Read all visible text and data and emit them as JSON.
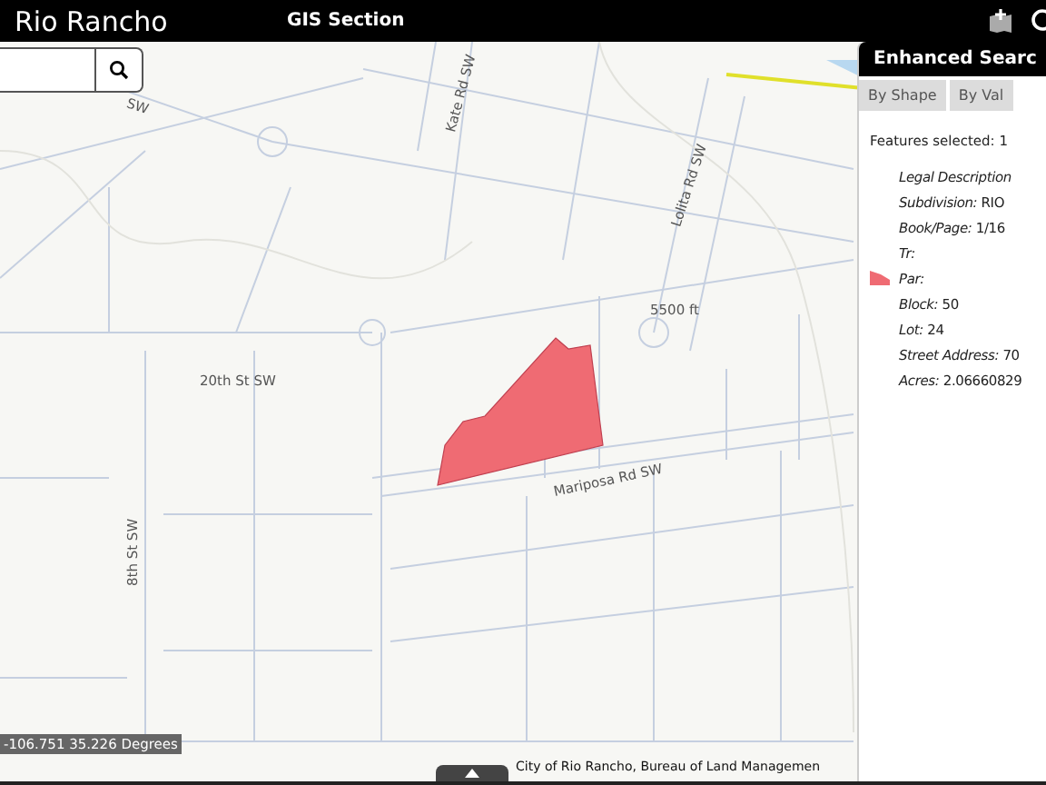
{
  "header": {
    "title": "Rio Rancho",
    "section": "GIS Section"
  },
  "map": {
    "labels": [
      "SW",
      "Kate Rd SW",
      "Lolita Rd SW",
      "5500 ft",
      "20th St SW",
      "8th St SW",
      "Mariposa Rd SW"
    ],
    "coordinates": "-106.751 35.226 Degrees",
    "attribution": "City of Rio Rancho, Bureau of Land Managemen"
  },
  "panel": {
    "title": "Enhanced Searc",
    "tabs": [
      {
        "label": "By Shape",
        "selected": false
      },
      {
        "label": "By Val",
        "selected": false
      }
    ],
    "summary": "Features selected: 1",
    "fields": [
      {
        "kind": "text",
        "label": "Legal Description"
      },
      {
        "kind": "text",
        "label": "Subdivision:",
        "value": "RIO"
      },
      {
        "kind": "text",
        "label": "Book/Page:",
        "value": "1/16"
      },
      {
        "kind": "text",
        "label": "Tr:"
      },
      {
        "kind": "legend",
        "label": "Par:"
      },
      {
        "kind": "text",
        "label": "Block:",
        "value": "50"
      },
      {
        "kind": "text",
        "label": "Lot:",
        "value": "24"
      },
      {
        "kind": "text",
        "label": "Street Address:",
        "value": "70"
      },
      {
        "kind": "text",
        "label": "Acres:",
        "value": "2.06660829"
      }
    ]
  }
}
